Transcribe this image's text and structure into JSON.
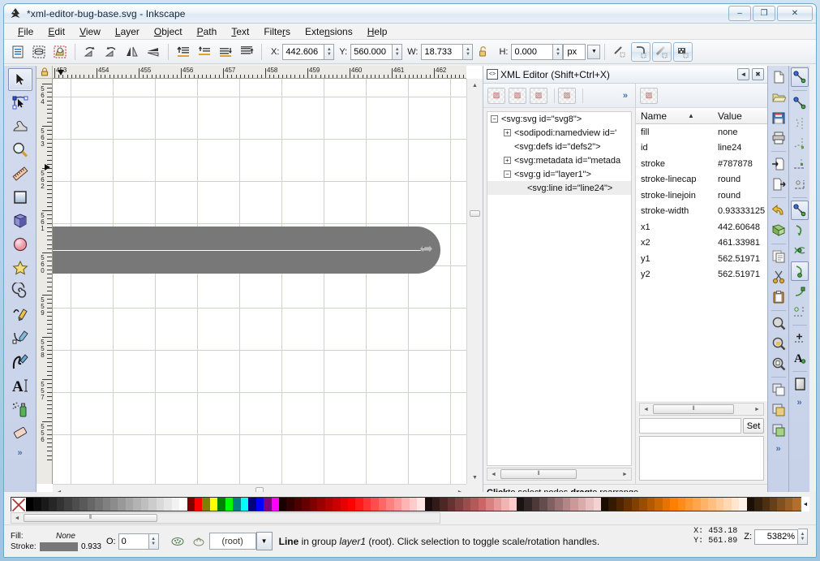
{
  "window": {
    "title": "*xml-editor-bug-base.svg - Inkscape",
    "minimize_label": "–",
    "maximize_label": "❐",
    "close_label": "✕",
    "app_icon": "inkscape-logo-icon"
  },
  "menubar": {
    "items": [
      {
        "label": "File",
        "mnemonic": "F"
      },
      {
        "label": "Edit",
        "mnemonic": "E"
      },
      {
        "label": "View",
        "mnemonic": "V"
      },
      {
        "label": "Layer",
        "mnemonic": "L"
      },
      {
        "label": "Object",
        "mnemonic": "O"
      },
      {
        "label": "Path",
        "mnemonic": "P"
      },
      {
        "label": "Text",
        "mnemonic": "T"
      },
      {
        "label": "Filters",
        "mnemonic": "r"
      },
      {
        "label": "Extensions",
        "mnemonic": "n"
      },
      {
        "label": "Help",
        "mnemonic": "H"
      }
    ]
  },
  "tool_controls": {
    "buttons": [
      "select-all-icon",
      "select-all-in-layers-icon",
      "deselect-icon",
      "rotate-90-ccw-icon",
      "rotate-90-cw-icon",
      "flip-horizontal-icon",
      "flip-vertical-icon",
      "raise-to-top-icon",
      "raise-icon",
      "lower-icon",
      "lower-to-bottom-icon"
    ],
    "x_label": "X:",
    "x_value": "442.606",
    "y_label": "Y:",
    "y_value": "560.000",
    "w_label": "W:",
    "w_value": "18.733",
    "lock_icon": "lock-open-icon",
    "h_label": "H:",
    "h_value": "0.000",
    "unit_value": "px",
    "affect_buttons": [
      "affect-stroke-width-icon",
      "affect-rounded-corners-icon",
      "affect-gradients-icon",
      "affect-patterns-icon"
    ]
  },
  "toolbox": {
    "tools": [
      {
        "name": "selector-tool",
        "icon": "arrow-pointer-icon",
        "active": true
      },
      {
        "name": "node-tool",
        "icon": "node-editor-icon",
        "active": false
      },
      {
        "name": "tweak-tool",
        "icon": "tweak-icon",
        "active": false
      },
      {
        "name": "zoom-tool",
        "icon": "magnifier-icon",
        "active": false
      },
      {
        "name": "measure-tool",
        "icon": "ruler-icon",
        "active": false
      },
      {
        "name": "rectangle-tool",
        "icon": "square-icon",
        "active": false
      },
      {
        "name": "3dbox-tool",
        "icon": "cube-icon",
        "active": false
      },
      {
        "name": "ellipse-tool",
        "icon": "circle-icon",
        "active": false
      },
      {
        "name": "star-tool",
        "icon": "star-icon",
        "active": false
      },
      {
        "name": "spiral-tool",
        "icon": "spiral-icon",
        "active": false
      },
      {
        "name": "pencil-tool",
        "icon": "pencil-icon",
        "active": false
      },
      {
        "name": "bezier-tool",
        "icon": "pen-icon",
        "active": false
      },
      {
        "name": "calligraphy-tool",
        "icon": "calligraphy-pen-icon",
        "active": false
      },
      {
        "name": "text-tool",
        "icon": "text-a-icon",
        "active": false
      },
      {
        "name": "spray-tool",
        "icon": "spray-can-icon",
        "active": false
      },
      {
        "name": "eraser-tool",
        "icon": "eraser-icon",
        "active": false
      }
    ],
    "overflow_label": "»"
  },
  "canvas": {
    "hruler_labels": [
      "453",
      "454",
      "455",
      "456",
      "457",
      "458",
      "459",
      "460",
      "461",
      "462"
    ],
    "vruler_labels": [
      "564",
      "563",
      "562",
      "561",
      "560",
      "559",
      "558",
      "557",
      "556"
    ],
    "shape_name": "selected-line-object",
    "shape_color": "#787878",
    "selection_handle_icon": "horizontal-scale-arrow-icon",
    "lock_icon": "ruler-lock-icon",
    "zoom_corner_icon": "zoom-page-icon"
  },
  "xml_editor": {
    "title": "XML Editor (Shift+Ctrl+X)",
    "title_icon": "xml-tag-icon",
    "collapse_label": "◄",
    "close_label": "✖",
    "toolbar_buttons": [
      "new-element-node-icon",
      "new-text-node-icon",
      "duplicate-node-icon",
      "delete-node-icon"
    ],
    "toolbar_overflow": "»",
    "attr_toolbar_buttons": [
      "new-attribute-icon"
    ],
    "tree": [
      {
        "indent": 0,
        "expander": "minus",
        "label": "<svg:svg id=\"svg8\">",
        "selected": false
      },
      {
        "indent": 1,
        "expander": "plus",
        "label": "<sodipodi:namedview id='",
        "selected": false
      },
      {
        "indent": 1,
        "expander": "none",
        "label": "<svg:defs id=\"defs2\">",
        "selected": false
      },
      {
        "indent": 1,
        "expander": "plus",
        "label": "<svg:metadata id=\"metada",
        "selected": false
      },
      {
        "indent": 1,
        "expander": "minus",
        "label": "<svg:g id=\"layer1\">",
        "selected": false
      },
      {
        "indent": 2,
        "expander": "none",
        "label": "<svg:line id=\"line24\">",
        "selected": true
      }
    ],
    "attr_headers": {
      "name": "Name",
      "value": "Value",
      "sort_icon": "sort-ascending-icon"
    },
    "attributes": [
      {
        "name": "fill",
        "value": "none"
      },
      {
        "name": "id",
        "value": "line24"
      },
      {
        "name": "stroke",
        "value": "#787878"
      },
      {
        "name": "stroke-linecap",
        "value": "round"
      },
      {
        "name": "stroke-linejoin",
        "value": "round"
      },
      {
        "name": "stroke-width",
        "value": "0.93333125"
      },
      {
        "name": "x1",
        "value": "442.60648"
      },
      {
        "name": "x2",
        "value": "461.33981"
      },
      {
        "name": "y1",
        "value": "562.51971"
      },
      {
        "name": "y2",
        "value": "562.51971"
      }
    ],
    "value_input_value": "",
    "set_button_label": "Set",
    "value_textarea_value": "",
    "status_parts": [
      "Click",
      " to select nodes, ",
      "drag",
      " to rearrange."
    ]
  },
  "command_bar": {
    "buttons": [
      "new-document-icon",
      "open-document-icon",
      "save-document-icon",
      "print-icon",
      "import-icon",
      "export-icon",
      "undo-icon",
      "redo-icon",
      "copy-icon",
      "cut-icon",
      "paste-icon",
      "zoom-selection-icon",
      "zoom-drawing-icon",
      "zoom-page-icon",
      "duplicate-icon",
      "group-icon",
      "ungroup-icon"
    ],
    "overflow_label": "»"
  },
  "snap_bar": {
    "buttons": [
      "enable-snapping-icon",
      "snap-bounding-box-icon",
      "snap-bbox-edge-icon",
      "snap-bbox-corner-icon",
      "snap-bbox-edge-midpoint-icon",
      "snap-bbox-center-icon",
      "snap-nodes-icon",
      "snap-path-icon",
      "snap-path-intersection-icon",
      "snap-cusp-node-icon",
      "snap-smooth-node-icon",
      "snap-midpoint-icon",
      "snap-object-center-icon",
      "snap-text-baseline-icon",
      "snap-page-border-icon"
    ],
    "overflow_label": "»"
  },
  "palette": {
    "no-color-label": "X",
    "scroll_right_label": "◄",
    "colors": [
      "#000000",
      "#0d0d0d",
      "#1a1a1a",
      "#262626",
      "#333333",
      "#404040",
      "#4d4d4d",
      "#595959",
      "#666666",
      "#737373",
      "#808080",
      "#8c8c8c",
      "#999999",
      "#a6a6a6",
      "#b3b3b3",
      "#bfbfbf",
      "#cccccc",
      "#d9d9d9",
      "#e6e6e6",
      "#f2f2f2",
      "#ffffff",
      "#800000",
      "#ff0000",
      "#808000",
      "#ffff00",
      "#008000",
      "#00ff00",
      "#008080",
      "#00ffff",
      "#000080",
      "#0000ff",
      "#800080",
      "#ff00ff",
      "#1a0000",
      "#330000",
      "#4d0000",
      "#660000",
      "#800000",
      "#990000",
      "#b30000",
      "#cc0000",
      "#e60000",
      "#ff0000",
      "#ff1a1a",
      "#ff3333",
      "#ff4d4d",
      "#ff6666",
      "#ff8080",
      "#ff9999",
      "#ffb3b3",
      "#ffcccc",
      "#ffe6e6",
      "#1a0d0d",
      "#331a1a",
      "#4d2626",
      "#663333",
      "#804040",
      "#994d4d",
      "#b35959",
      "#cc6666",
      "#d98080",
      "#e69999",
      "#f2b3b3",
      "#ffcccc",
      "#1a1313",
      "#332626",
      "#4d3939",
      "#664d4d",
      "#806060",
      "#997373",
      "#b38686",
      "#cc9999",
      "#d9acac",
      "#e6bfbf",
      "#f2d2d2",
      "#1a0d00",
      "#331a00",
      "#4d2600",
      "#663300",
      "#804000",
      "#994d00",
      "#b35900",
      "#cc6600",
      "#e67300",
      "#ff8000",
      "#ff8c1a",
      "#ff9933",
      "#ffa64d",
      "#ffb366",
      "#ffbf80",
      "#ffcc99",
      "#ffd9b3",
      "#ffe6cc",
      "#fff2e6",
      "#1a1006",
      "#33200d",
      "#4d3013",
      "#66401a",
      "#805020",
      "#996026",
      "#b3702d",
      "#cc8033"
    ]
  },
  "status_bar": {
    "fill_label": "Fill:",
    "fill_value": "None",
    "stroke_label": "Stroke:",
    "stroke_color": "#787878",
    "stroke_width": "0.933",
    "opacity_label": "O:",
    "opacity_value": "0",
    "visibility_icon": "layer-visible-icon",
    "lock_icon": "layer-lock-icon",
    "layer_value": "(root)",
    "status_message_prefix": "Line",
    "status_message_middle": " in group ",
    "status_message_layer": "layer1",
    "status_message_suffix": " (root). Click selection to toggle scale/rotation handles.",
    "x_label": "X:",
    "x_value": "453.18",
    "y_label": "Y:",
    "y_value": "561.89",
    "zoom_label": "Z:",
    "zoom_value": "5382%"
  }
}
